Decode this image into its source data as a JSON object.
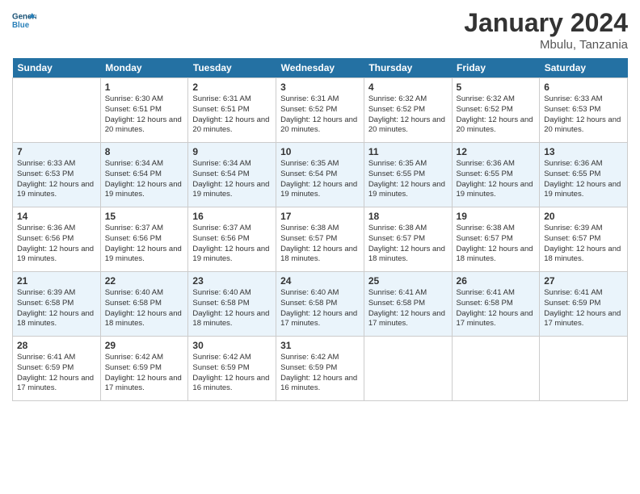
{
  "header": {
    "logo_line1": "General",
    "logo_line2": "Blue",
    "month_title": "January 2024",
    "location": "Mbulu, Tanzania"
  },
  "days_of_week": [
    "Sunday",
    "Monday",
    "Tuesday",
    "Wednesday",
    "Thursday",
    "Friday",
    "Saturday"
  ],
  "weeks": [
    [
      {
        "day": "",
        "sunrise": "",
        "sunset": "",
        "daylight": ""
      },
      {
        "day": "1",
        "sunrise": "Sunrise: 6:30 AM",
        "sunset": "Sunset: 6:51 PM",
        "daylight": "Daylight: 12 hours and 20 minutes."
      },
      {
        "day": "2",
        "sunrise": "Sunrise: 6:31 AM",
        "sunset": "Sunset: 6:51 PM",
        "daylight": "Daylight: 12 hours and 20 minutes."
      },
      {
        "day": "3",
        "sunrise": "Sunrise: 6:31 AM",
        "sunset": "Sunset: 6:52 PM",
        "daylight": "Daylight: 12 hours and 20 minutes."
      },
      {
        "day": "4",
        "sunrise": "Sunrise: 6:32 AM",
        "sunset": "Sunset: 6:52 PM",
        "daylight": "Daylight: 12 hours and 20 minutes."
      },
      {
        "day": "5",
        "sunrise": "Sunrise: 6:32 AM",
        "sunset": "Sunset: 6:52 PM",
        "daylight": "Daylight: 12 hours and 20 minutes."
      },
      {
        "day": "6",
        "sunrise": "Sunrise: 6:33 AM",
        "sunset": "Sunset: 6:53 PM",
        "daylight": "Daylight: 12 hours and 20 minutes."
      }
    ],
    [
      {
        "day": "7",
        "sunrise": "Sunrise: 6:33 AM",
        "sunset": "Sunset: 6:53 PM",
        "daylight": "Daylight: 12 hours and 19 minutes."
      },
      {
        "day": "8",
        "sunrise": "Sunrise: 6:34 AM",
        "sunset": "Sunset: 6:54 PM",
        "daylight": "Daylight: 12 hours and 19 minutes."
      },
      {
        "day": "9",
        "sunrise": "Sunrise: 6:34 AM",
        "sunset": "Sunset: 6:54 PM",
        "daylight": "Daylight: 12 hours and 19 minutes."
      },
      {
        "day": "10",
        "sunrise": "Sunrise: 6:35 AM",
        "sunset": "Sunset: 6:54 PM",
        "daylight": "Daylight: 12 hours and 19 minutes."
      },
      {
        "day": "11",
        "sunrise": "Sunrise: 6:35 AM",
        "sunset": "Sunset: 6:55 PM",
        "daylight": "Daylight: 12 hours and 19 minutes."
      },
      {
        "day": "12",
        "sunrise": "Sunrise: 6:36 AM",
        "sunset": "Sunset: 6:55 PM",
        "daylight": "Daylight: 12 hours and 19 minutes."
      },
      {
        "day": "13",
        "sunrise": "Sunrise: 6:36 AM",
        "sunset": "Sunset: 6:55 PM",
        "daylight": "Daylight: 12 hours and 19 minutes."
      }
    ],
    [
      {
        "day": "14",
        "sunrise": "Sunrise: 6:36 AM",
        "sunset": "Sunset: 6:56 PM",
        "daylight": "Daylight: 12 hours and 19 minutes."
      },
      {
        "day": "15",
        "sunrise": "Sunrise: 6:37 AM",
        "sunset": "Sunset: 6:56 PM",
        "daylight": "Daylight: 12 hours and 19 minutes."
      },
      {
        "day": "16",
        "sunrise": "Sunrise: 6:37 AM",
        "sunset": "Sunset: 6:56 PM",
        "daylight": "Daylight: 12 hours and 19 minutes."
      },
      {
        "day": "17",
        "sunrise": "Sunrise: 6:38 AM",
        "sunset": "Sunset: 6:57 PM",
        "daylight": "Daylight: 12 hours and 18 minutes."
      },
      {
        "day": "18",
        "sunrise": "Sunrise: 6:38 AM",
        "sunset": "Sunset: 6:57 PM",
        "daylight": "Daylight: 12 hours and 18 minutes."
      },
      {
        "day": "19",
        "sunrise": "Sunrise: 6:38 AM",
        "sunset": "Sunset: 6:57 PM",
        "daylight": "Daylight: 12 hours and 18 minutes."
      },
      {
        "day": "20",
        "sunrise": "Sunrise: 6:39 AM",
        "sunset": "Sunset: 6:57 PM",
        "daylight": "Daylight: 12 hours and 18 minutes."
      }
    ],
    [
      {
        "day": "21",
        "sunrise": "Sunrise: 6:39 AM",
        "sunset": "Sunset: 6:58 PM",
        "daylight": "Daylight: 12 hours and 18 minutes."
      },
      {
        "day": "22",
        "sunrise": "Sunrise: 6:40 AM",
        "sunset": "Sunset: 6:58 PM",
        "daylight": "Daylight: 12 hours and 18 minutes."
      },
      {
        "day": "23",
        "sunrise": "Sunrise: 6:40 AM",
        "sunset": "Sunset: 6:58 PM",
        "daylight": "Daylight: 12 hours and 18 minutes."
      },
      {
        "day": "24",
        "sunrise": "Sunrise: 6:40 AM",
        "sunset": "Sunset: 6:58 PM",
        "daylight": "Daylight: 12 hours and 17 minutes."
      },
      {
        "day": "25",
        "sunrise": "Sunrise: 6:41 AM",
        "sunset": "Sunset: 6:58 PM",
        "daylight": "Daylight: 12 hours and 17 minutes."
      },
      {
        "day": "26",
        "sunrise": "Sunrise: 6:41 AM",
        "sunset": "Sunset: 6:58 PM",
        "daylight": "Daylight: 12 hours and 17 minutes."
      },
      {
        "day": "27",
        "sunrise": "Sunrise: 6:41 AM",
        "sunset": "Sunset: 6:59 PM",
        "daylight": "Daylight: 12 hours and 17 minutes."
      }
    ],
    [
      {
        "day": "28",
        "sunrise": "Sunrise: 6:41 AM",
        "sunset": "Sunset: 6:59 PM",
        "daylight": "Daylight: 12 hours and 17 minutes."
      },
      {
        "day": "29",
        "sunrise": "Sunrise: 6:42 AM",
        "sunset": "Sunset: 6:59 PM",
        "daylight": "Daylight: 12 hours and 17 minutes."
      },
      {
        "day": "30",
        "sunrise": "Sunrise: 6:42 AM",
        "sunset": "Sunset: 6:59 PM",
        "daylight": "Daylight: 12 hours and 16 minutes."
      },
      {
        "day": "31",
        "sunrise": "Sunrise: 6:42 AM",
        "sunset": "Sunset: 6:59 PM",
        "daylight": "Daylight: 12 hours and 16 minutes."
      },
      {
        "day": "",
        "sunrise": "",
        "sunset": "",
        "daylight": ""
      },
      {
        "day": "",
        "sunrise": "",
        "sunset": "",
        "daylight": ""
      },
      {
        "day": "",
        "sunrise": "",
        "sunset": "",
        "daylight": ""
      }
    ]
  ]
}
